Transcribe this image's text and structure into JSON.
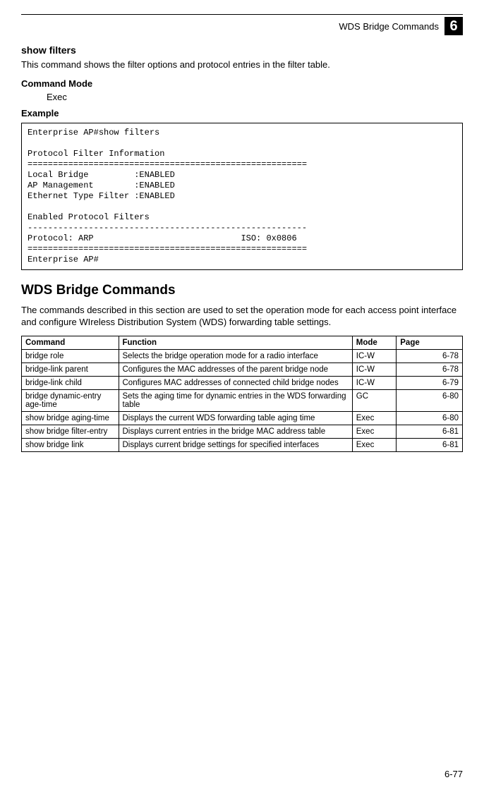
{
  "header": {
    "title": "WDS Bridge Commands",
    "chapter": "6"
  },
  "sections": {
    "showfilters": {
      "title": "show filters",
      "desc": "This command shows the filter options and protocol entries in the filter table.",
      "mode_label": "Command Mode",
      "mode_value": "Exec",
      "example_label": "Example",
      "code": "Enterprise AP#show filters\n\nProtocol Filter Information\n=======================================================\nLocal Bridge         :ENABLED\nAP Management        :ENABLED\nEthernet Type Filter :ENABLED\n\nEnabled Protocol Filters\n-------------------------------------------------------\nProtocol: ARP                             ISO: 0x0806\n=======================================================\nEnterprise AP#"
    },
    "wds": {
      "title": "WDS Bridge Commands",
      "desc": "The commands described in this section are used to set the operation mode for each access point interface and configure WIreless Distribution System (WDS) forwarding table settings."
    }
  },
  "table": {
    "headers": [
      "Command",
      "Function",
      "Mode",
      "Page"
    ],
    "rows": [
      {
        "c0": "bridge role",
        "c1": "Selects the bridge operation mode for a radio interface",
        "c2": "IC-W",
        "c3": "6-78"
      },
      {
        "c0": "bridge-link parent",
        "c1": "Configures the MAC addresses of the parent bridge node",
        "c2": "IC-W",
        "c3": "6-78"
      },
      {
        "c0": "bridge-link child",
        "c1": "Configures MAC addresses of connected child bridge nodes",
        "c2": "IC-W",
        "c3": "6-79"
      },
      {
        "c0": "bridge dynamic-entry age-time",
        "c1": "Sets the aging time for dynamic entries in the WDS forwarding table",
        "c2": "GC",
        "c3": "6-80"
      },
      {
        "c0": "show bridge aging-time",
        "c1": "Displays the current WDS forwarding table aging time",
        "c2": "Exec",
        "c3": "6-80"
      },
      {
        "c0": "show bridge filter-entry",
        "c1": "Displays current entries in the bridge MAC address table",
        "c2": "Exec",
        "c3": "6-81"
      },
      {
        "c0": "show bridge link",
        "c1": "Displays current bridge settings for specified interfaces",
        "c2": "Exec",
        "c3": "6-81"
      }
    ]
  },
  "footer": {
    "pagenum": "6-77"
  }
}
